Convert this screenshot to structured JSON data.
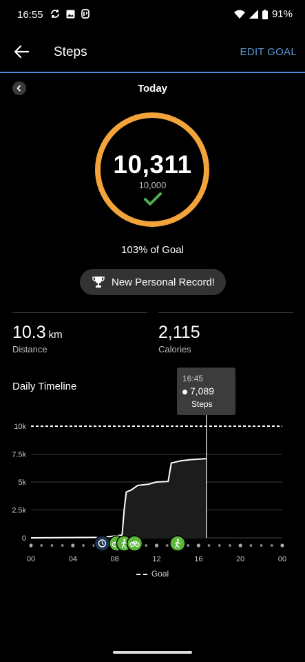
{
  "status_bar": {
    "time": "16:55",
    "battery": "91%"
  },
  "app_bar": {
    "title": "Steps",
    "edit_goal": "EDIT GOAL"
  },
  "date_nav": {
    "label": "Today"
  },
  "summary": {
    "steps": "10,311",
    "goal": "10,000",
    "percent_text": "103% of Goal",
    "record_text": "New Personal Record!",
    "ring_color": "#f2a33a",
    "check_color": "#4caf50",
    "progress_fraction": 1.03
  },
  "stats": {
    "distance_value": "10.3",
    "distance_unit": "km",
    "distance_label": "Distance",
    "calories_value": "2,115",
    "calories_label": "Calories"
  },
  "timeline": {
    "title": "Daily Timeline",
    "tooltip": {
      "time": "16:45",
      "value": "7,089",
      "label": "Steps"
    },
    "legend": "Goal"
  },
  "chart_data": {
    "type": "area",
    "y_tick_labels": [
      "10k",
      "7.5k",
      "5k",
      "2.5k",
      "0"
    ],
    "y_ticks": [
      10000,
      7500,
      5000,
      2500,
      0
    ],
    "x_tick_labels": [
      "00",
      "04",
      "08",
      "12",
      "16",
      "20",
      "00"
    ],
    "x_ticks": [
      0,
      4,
      8,
      12,
      16,
      20,
      24
    ],
    "xlim": [
      0,
      24
    ],
    "ylim": [
      0,
      10000
    ],
    "goal": 10000,
    "cursor_hour": 16.75,
    "points": [
      [
        0,
        0
      ],
      [
        6.5,
        50
      ],
      [
        7.8,
        150
      ],
      [
        8.7,
        250
      ],
      [
        8.9,
        2500
      ],
      [
        9.1,
        4100
      ],
      [
        9.6,
        4300
      ],
      [
        10.2,
        4700
      ],
      [
        11.2,
        4800
      ],
      [
        12.0,
        5000
      ],
      [
        13.1,
        5050
      ],
      [
        13.4,
        6700
      ],
      [
        14.3,
        6900
      ],
      [
        15.2,
        7000
      ],
      [
        16.75,
        7089
      ]
    ],
    "activities": [
      {
        "hour": 6.8,
        "icon": "alarm-icon",
        "color": "#1e3550"
      },
      {
        "hour": 8.2,
        "icon": "bike-icon",
        "color": "#5cb83a"
      },
      {
        "hour": 8.9,
        "icon": "walk-icon",
        "color": "#5cb83a"
      },
      {
        "hour": 9.9,
        "icon": "bike-icon",
        "color": "#5cb83a"
      },
      {
        "hour": 14.0,
        "icon": "walk-icon",
        "color": "#5cb83a"
      }
    ]
  }
}
